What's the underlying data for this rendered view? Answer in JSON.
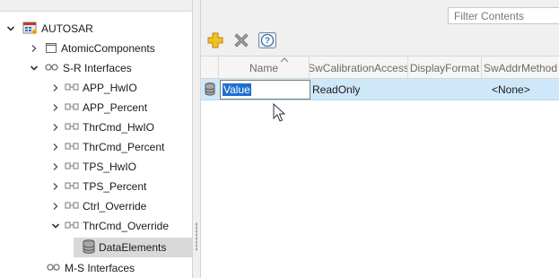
{
  "tree": {
    "root": {
      "label": "AUTOSAR",
      "expanded": true
    },
    "items": [
      {
        "label": "AtomicComponents",
        "expanded": false,
        "icon": "box-icon"
      },
      {
        "label": "S-R Interfaces",
        "expanded": true,
        "icon": "interfaces-icon"
      },
      {
        "label": "APP_HwIO",
        "expanded": false,
        "icon": "interface-icon"
      },
      {
        "label": "APP_Percent",
        "expanded": false,
        "icon": "interface-icon"
      },
      {
        "label": "ThrCmd_HwIO",
        "expanded": false,
        "icon": "interface-icon"
      },
      {
        "label": "ThrCmd_Percent",
        "expanded": false,
        "icon": "interface-icon"
      },
      {
        "label": "TPS_HwIO",
        "expanded": false,
        "icon": "interface-icon"
      },
      {
        "label": "TPS_Percent",
        "expanded": false,
        "icon": "interface-icon"
      },
      {
        "label": "Ctrl_Override",
        "expanded": false,
        "icon": "interface-icon"
      },
      {
        "label": "ThrCmd_Override",
        "expanded": true,
        "icon": "interface-icon"
      },
      {
        "label": "DataElements",
        "selected": true,
        "icon": "database-icon"
      },
      {
        "label": "M-S Interfaces",
        "icon": "interfaces-icon"
      }
    ]
  },
  "toolbar": {
    "filter_value": "Filter Contents",
    "add_icon": "add-icon",
    "delete_icon": "delete-icon",
    "help_icon": "help-icon"
  },
  "grid": {
    "columns": [
      "Name",
      "SwCalibrationAccess",
      "DisplayFormat",
      "SwAddrMethod"
    ],
    "rows": [
      {
        "name": "Value",
        "sw_calibration_access": "ReadOnly",
        "display_format": "",
        "sw_addr_method": "<None>"
      }
    ]
  },
  "colors": {
    "row_selected": "#cfe8f9",
    "edit_selection": "#1e6fd0"
  }
}
